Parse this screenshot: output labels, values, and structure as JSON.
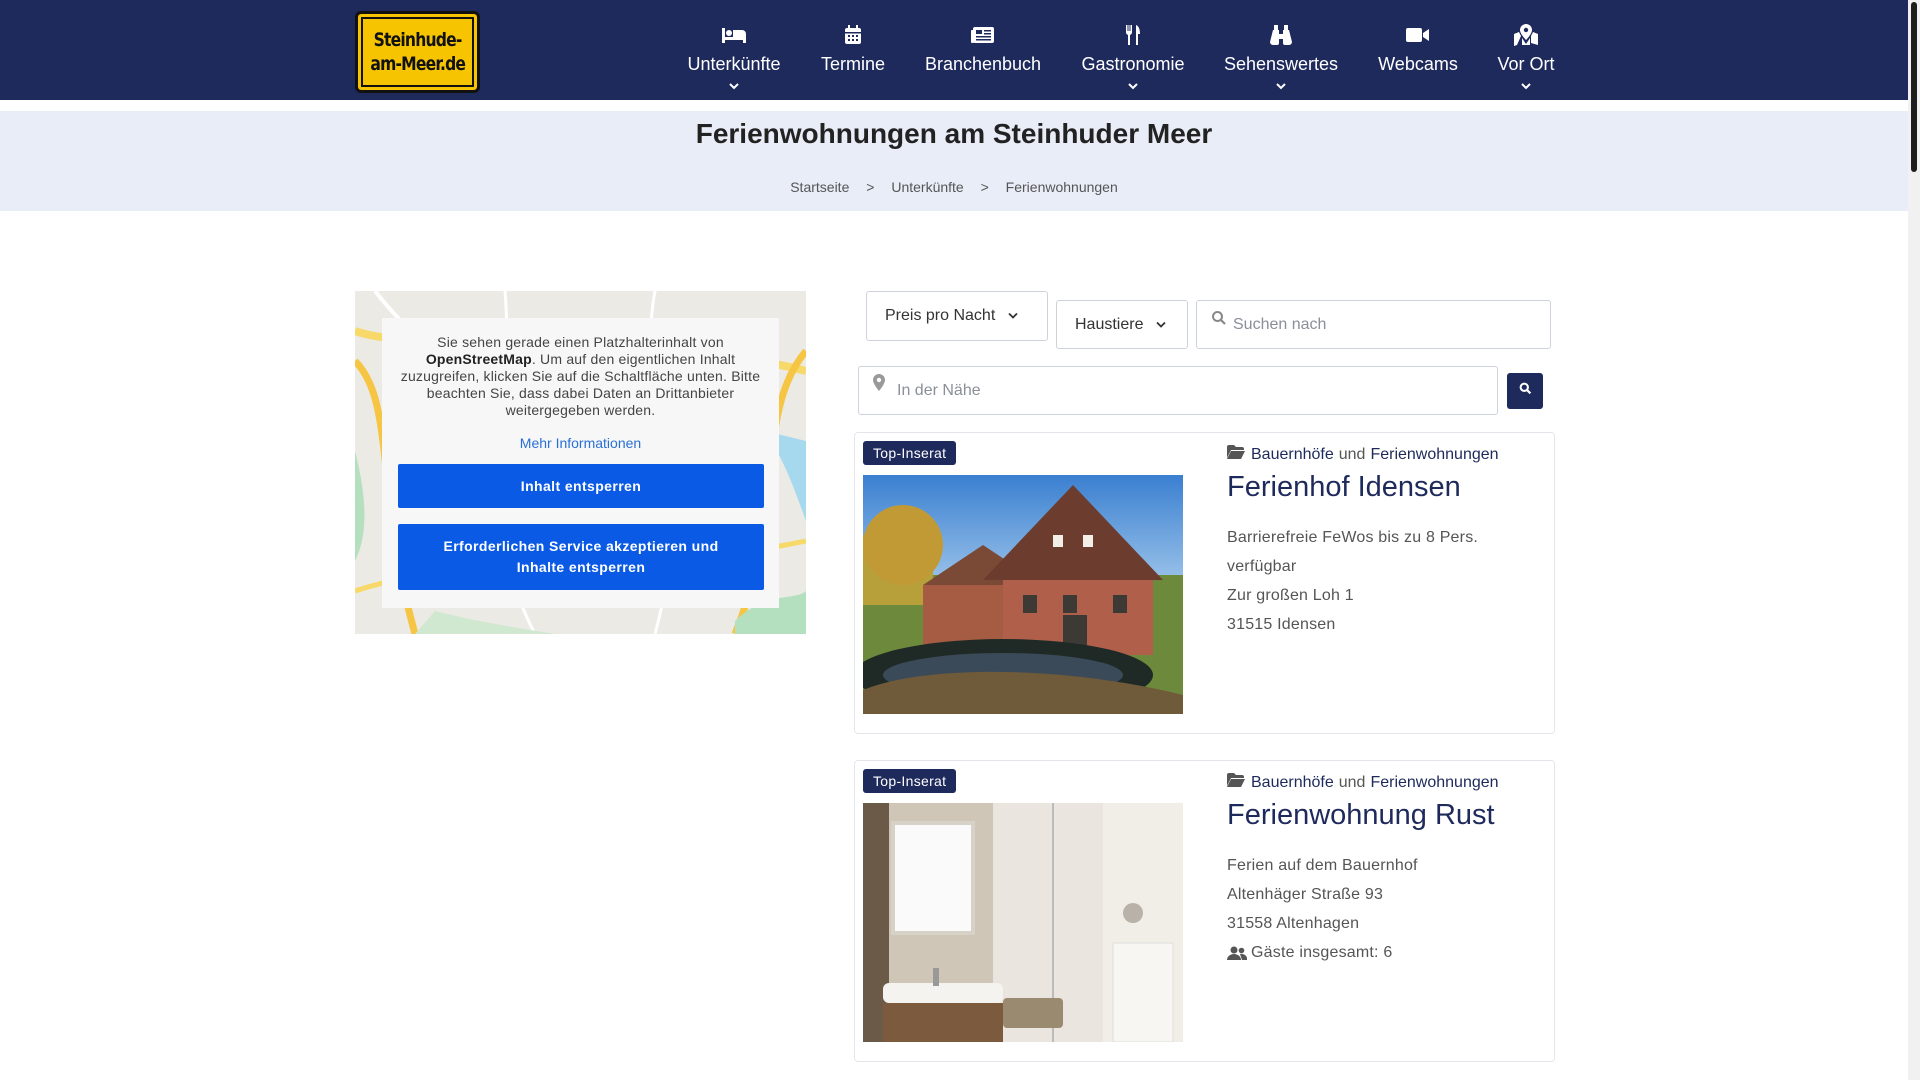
{
  "logo": {
    "line1": "Steinhude-",
    "line2": "am-Meer.de"
  },
  "nav": [
    {
      "label": "Unterkünfte",
      "icon": "bed-icon",
      "has_dropdown": true
    },
    {
      "label": "Termine",
      "icon": "calendar-icon",
      "has_dropdown": false
    },
    {
      "label": "Branchenbuch",
      "icon": "newspaper-icon",
      "has_dropdown": false
    },
    {
      "label": "Gastronomie",
      "icon": "utensils-icon",
      "has_dropdown": true
    },
    {
      "label": "Sehenswertes",
      "icon": "binoculars-icon",
      "has_dropdown": true
    },
    {
      "label": "Webcams",
      "icon": "video-camera-icon",
      "has_dropdown": false
    },
    {
      "label": "Vor Ort",
      "icon": "map-location-icon",
      "has_dropdown": true
    }
  ],
  "page": {
    "title": "Ferienwohnungen am Steinhuder Meer",
    "breadcrumb": [
      "Startseite",
      "Unterkünfte",
      "Ferienwohnungen"
    ],
    "breadcrumb_sep": ">"
  },
  "map_consent": {
    "text_before": "Sie sehen gerade einen Platzhalterinhalt von ",
    "provider": "OpenStreetMap",
    "text_after": ". Um auf den eigentlichen Inhalt zuzugreifen, klicken Sie auf die Schaltfläche unten. Bitte beachten Sie, dass dabei Daten an Drittanbieter weitergegeben werden.",
    "more_link": "Mehr Informationen",
    "unlock_button": "Inhalt entsperren",
    "accept_button": "Erforderlichen Service akzeptieren und Inhalte entsperren"
  },
  "filters": {
    "price_dropdown": "Preis pro Nacht",
    "pets_dropdown": "Haustiere",
    "search_placeholder": "Suchen nach",
    "near_placeholder": "In der Nähe"
  },
  "listings": [
    {
      "badge": "Top-Inserat",
      "categories": [
        "Bauernhöfe",
        "Ferienwohnungen"
      ],
      "connector": "und",
      "title": "Ferienhof Idensen",
      "lines": [
        "Barrierefreie FeWos bis zu 8 Pers.",
        "verfügbar",
        "Zur großen Loh 1",
        "31515 Idensen"
      ]
    },
    {
      "badge": "Top-Inserat",
      "categories": [
        "Bauernhöfe",
        "Ferienwohnungen"
      ],
      "connector": "und",
      "title": "Ferienwohnung Rust",
      "lines": [
        "Ferien auf dem Bauernhof",
        "Altenhäger Straße 93",
        "31558 Altenhagen"
      ],
      "guests": "Gäste insgesamt: 6"
    }
  ],
  "colors": {
    "header_bg": "#1f2a5c",
    "title_band": "#e8edf7",
    "consent_button": "#0a5ae6",
    "logo_yellow": "#f6c400"
  }
}
